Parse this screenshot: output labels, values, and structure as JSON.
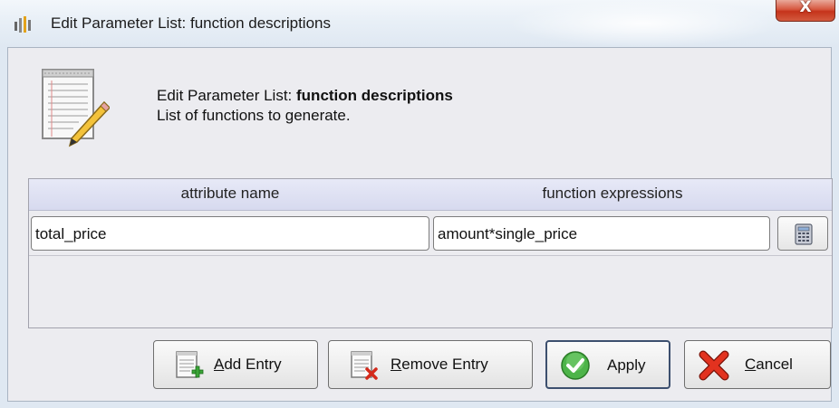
{
  "window": {
    "title": "Edit Parameter List: function descriptions",
    "close_label": "X"
  },
  "header": {
    "prefix": "Edit Parameter List: ",
    "name": "function descriptions",
    "description": "List of functions to generate."
  },
  "table": {
    "columns": [
      "attribute name",
      "function expressions"
    ],
    "rows": [
      {
        "attribute": "total_price",
        "expression": "amount*single_price"
      }
    ]
  },
  "buttons": {
    "add": {
      "mnemonic": "A",
      "rest": "dd Entry"
    },
    "remove": {
      "mnemonic": "R",
      "rest": "emove Entry"
    },
    "apply": {
      "label": "Apply"
    },
    "cancel": {
      "mnemonic": "C",
      "rest": "ancel"
    }
  },
  "icons": {
    "app": "rapidminer-app-icon",
    "header": "notepad-pencil-icon",
    "calculator": "calculator-icon",
    "add": "add-entry-icon",
    "remove": "remove-entry-icon",
    "apply": "green-check-icon",
    "cancel": "red-x-icon"
  },
  "colors": {
    "close": "#c5331b",
    "header_row": "#d7daef",
    "apply_check": "#3fa33a",
    "cancel_x": "#d42a1b"
  }
}
